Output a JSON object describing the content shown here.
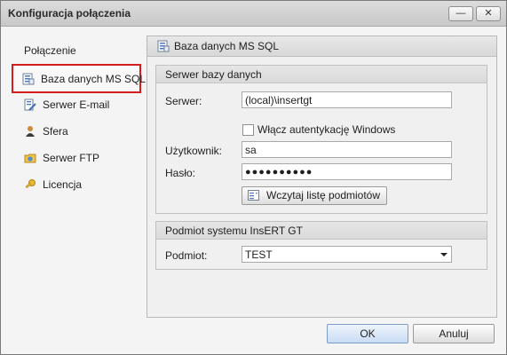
{
  "window": {
    "title": "Konfiguracja połączenia",
    "minimize_icon": "—",
    "close_icon": "✕"
  },
  "sidebar": {
    "title": "Połączenie",
    "items": [
      {
        "label": "Baza danych MS SQL",
        "icon": "database-icon",
        "selected": true
      },
      {
        "label": "Serwer E-mail",
        "icon": "mail-server-icon",
        "selected": false
      },
      {
        "label": "Sfera",
        "icon": "person-icon",
        "selected": false
      },
      {
        "label": "Serwer FTP",
        "icon": "ftp-folder-icon",
        "selected": false
      },
      {
        "label": "Licencja",
        "icon": "key-icon",
        "selected": false
      }
    ]
  },
  "panel": {
    "title": "Baza danych MS SQL",
    "server_group": {
      "title": "Serwer bazy danych",
      "server_label": "Serwer:",
      "server_value": "(local)\\insertgt",
      "windows_auth_label": "Włącz autentykację Windows",
      "windows_auth_checked": false,
      "user_label": "Użytkownik:",
      "user_value": "sa",
      "password_label": "Hasło:",
      "password_value": "●●●●●●●●●●",
      "load_button_label": "Wczytaj listę podmiotów"
    },
    "entity_group": {
      "title": "Podmiot systemu InsERT GT",
      "entity_label": "Podmiot:",
      "entity_value": "TEST"
    }
  },
  "footer": {
    "ok_label": "OK",
    "cancel_label": "Anuluj"
  },
  "colors": {
    "selection_outline": "#d61d1d",
    "primary_button": "#c9dcf4"
  }
}
